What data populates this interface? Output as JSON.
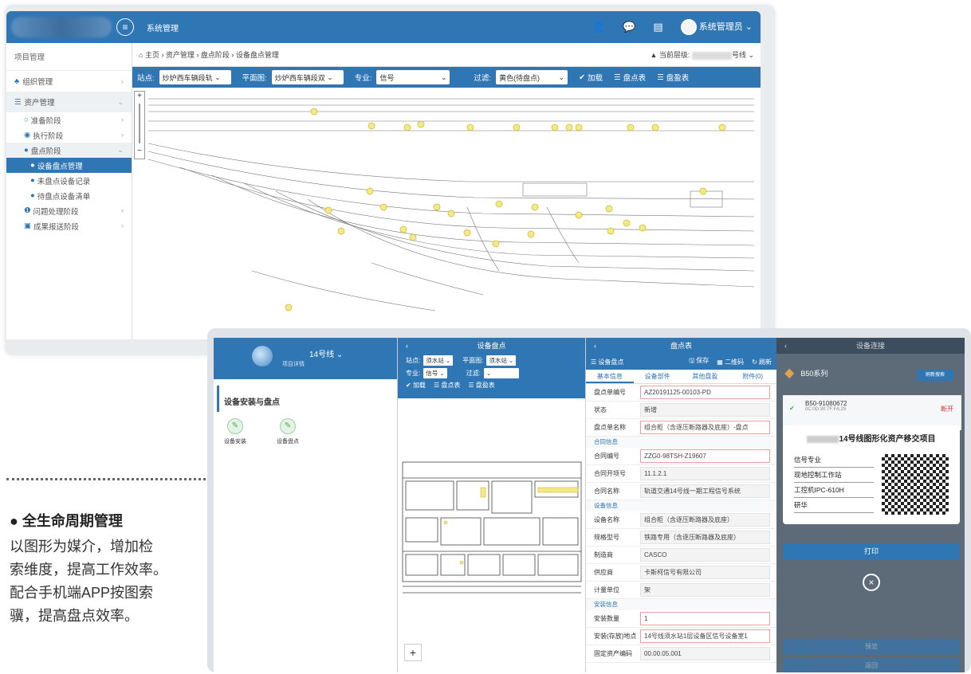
{
  "desktop": {
    "header": {
      "system_title": "系统管理",
      "user_label": "系统管理员"
    },
    "sidebar": {
      "heading": "项目管理",
      "items": [
        {
          "label": "组织管理",
          "icon": "org-icon"
        },
        {
          "label": "资产管理",
          "icon": "list-icon"
        }
      ],
      "sub_items": [
        "准备阶段",
        "执行阶段",
        "盘点阶段"
      ],
      "stage_items": [
        "设备盘点管理",
        "未盘点设备记录",
        "待盘点设备清单"
      ],
      "tail_items": [
        "问题处理阶段",
        "成果报送阶段"
      ]
    },
    "breadcrumb": {
      "text": "主页 › 资产管理 › 盘点阶段 › 设备盘点管理",
      "current_level_label": "当前层级:",
      "current_level_value": "号线"
    },
    "filter": {
      "station_label": "站点:",
      "station_value": "炒炉西车辆段轨",
      "plan_label": "平面图:",
      "plan_value": "炒炉西车辆段双",
      "major_label": "专业:",
      "major_value": "信号",
      "filter_label": "过滤:",
      "filter_value": "黄色(待盘点)",
      "load_label": "加载",
      "table_label": "盘点表",
      "surplus_label": "盘盈表"
    }
  },
  "mobile": {
    "panel1": {
      "line_title": "14号线",
      "subtitle": "项目详情",
      "section_title": "设备安装与盘点",
      "tiles": [
        "设备安装",
        "设备盘点"
      ]
    },
    "panel2": {
      "title": "设备盘点",
      "station_label": "站点:",
      "station_value": "须水站",
      "plan_label": "平面图:",
      "plan_value": "须水站",
      "major_label": "专业:",
      "major_value": "信号",
      "filter_label": "过滤:",
      "filter_value": "",
      "load_label": "加载",
      "table_label": "盘点表",
      "surplus_label": "盘盈表"
    },
    "panel3": {
      "title": "盘点表",
      "bar_title": "设备盘点",
      "save_label": "保存",
      "qr_label": "二维码",
      "refresh_label": "刷新",
      "tabs": [
        "基本信息",
        "设备部件",
        "其他盘盈",
        "附件(0)"
      ],
      "rows": [
        {
          "label": "盘点单编号",
          "value": "AZ20191125-00103-PD"
        },
        {
          "label": "状态",
          "value": "新增"
        },
        {
          "label": "盘点单名称",
          "value": "组合柜（含逐压断路器及底座）-盘点"
        }
      ],
      "section_contract": "合同信息",
      "contract_rows": [
        {
          "label": "合同编号",
          "value": "ZZG0-98TSH-Z19607"
        },
        {
          "label": "合同开项号",
          "value": "11.1.2.1"
        },
        {
          "label": "合同名称",
          "value": "轨道交通14号线一期工程信号系统"
        }
      ],
      "section_device": "设备信息",
      "device_rows": [
        {
          "label": "设备名称",
          "value": "组合柜（含逐压断路器及底座）"
        },
        {
          "label": "规格型号",
          "value": "铁路专用（含逐压断路器及底座）"
        },
        {
          "label": "制造商",
          "value": "CASCO"
        },
        {
          "label": "供应商",
          "value": "卡斯柯信号有限公司"
        },
        {
          "label": "计量单位",
          "value": "架"
        }
      ],
      "section_install": "安装信息",
      "install_rows": [
        {
          "label": "安装数量",
          "value": "1"
        },
        {
          "label": "安装(存放)地点",
          "value": "14号线须水站1层设备区信号设备室1"
        },
        {
          "label": "固定资产编码",
          "value": "00.00.05.001"
        }
      ]
    },
    "panel4": {
      "title": "设备连接",
      "device_series": "B50系列",
      "search_btn": "刷新搜索",
      "device_id": "B50-91080672",
      "device_mac": "0C:0D:30:7F:FA:25",
      "disconnect_label": "断开",
      "label_title": "14号线图形化资产移交项目",
      "label_rows": [
        "信号专业",
        "现地控制工作站",
        "工控机IPC-610H",
        "研华"
      ],
      "print_label": "打印",
      "preview_label": "预览",
      "return_label": "返回"
    }
  },
  "caption": {
    "title": "● 全生命周期管理",
    "lines": [
      "以图形为媒介，增加检",
      "索维度，提高工作效率。",
      "配合手机端APP按图索",
      "骥，提高盘点效率。"
    ]
  },
  "colors": {
    "primary": "#2f76b5",
    "highlight": "#f3e98a"
  }
}
